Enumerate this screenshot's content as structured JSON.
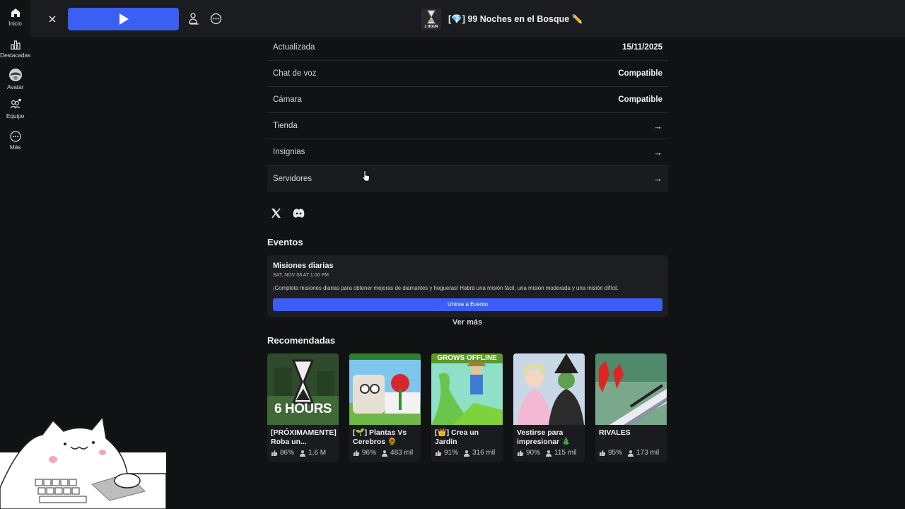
{
  "nav": {
    "items": [
      {
        "label": "Inicio",
        "icon": "home-icon"
      },
      {
        "label": "Destacadas",
        "icon": "chart-icon"
      },
      {
        "label": "Avatar",
        "icon": "avatar-icon"
      },
      {
        "label": "Equipo",
        "icon": "team-icon"
      },
      {
        "label": "Más",
        "icon": "more-icon"
      }
    ]
  },
  "topbar": {
    "game_title": "[💎] 99 Noches en el Bosque ✏️",
    "thumb_text": "1 HOUR"
  },
  "info_rows": [
    {
      "label": "Actualizada",
      "value": "15/11/2025"
    },
    {
      "label": "Chat de voz",
      "value": "Compatible"
    },
    {
      "label": "Cámara",
      "value": "Compatible"
    },
    {
      "label": "Tienda",
      "value": "→"
    },
    {
      "label": "Insignias",
      "value": "→"
    },
    {
      "label": "Servidores",
      "value": "→"
    }
  ],
  "events": {
    "heading": "Eventos",
    "title": "Misiones diarias",
    "date": "SAT, NOV 08 AT 1:00 PM",
    "description": "¡Completa misiones diarias para obtener mejoras de diamantes y hogueras! Habrá una misión fácil, una misión moderada y una misión difícil.",
    "button": "Unirse a Evento",
    "see_more": "Ver más"
  },
  "recommended": {
    "heading": "Recomendadas",
    "games": [
      {
        "title": "[PRÓXIMAMENTE] Roba un...",
        "rating": "86%",
        "players": "1,6 M",
        "thumb_text": "6 HOURS"
      },
      {
        "title": "[🌱] Plantas Vs Cerebros 🌻",
        "rating": "96%",
        "players": "483 mil",
        "thumb_text": ""
      },
      {
        "title": "[👑] Crea un Jardín",
        "rating": "91%",
        "players": "316 mil",
        "thumb_text": "GROWS OFFLINE"
      },
      {
        "title": "Vestirse para impresionar 🎄",
        "rating": "90%",
        "players": "115 mil",
        "thumb_text": ""
      },
      {
        "title": "RIVALES",
        "rating": "95%",
        "players": "173 mil",
        "thumb_text": ""
      }
    ]
  },
  "colors": {
    "accent": "#3a5ff2",
    "background": "#111214",
    "card": "#1d1e21"
  }
}
